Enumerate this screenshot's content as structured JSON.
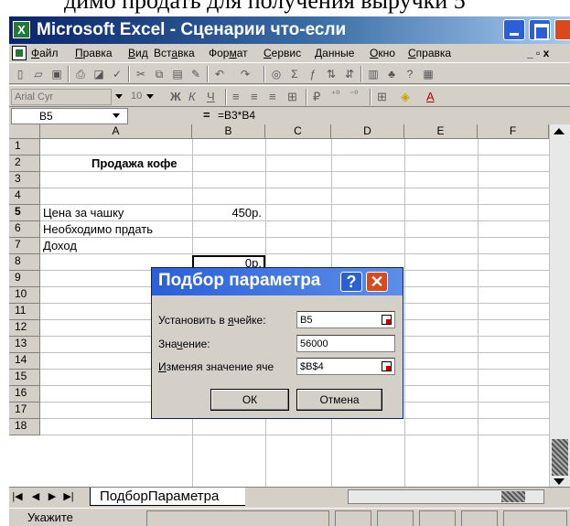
{
  "document_line": "димо продать для получения выручки 5",
  "window": {
    "title": "Microsoft Excel - Сценарии что-если",
    "app_icon": "excel-icon"
  },
  "menu": {
    "items": [
      {
        "pre": "",
        "u": "Ф",
        "post": "айл"
      },
      {
        "pre": "",
        "u": "П",
        "post": "равка"
      },
      {
        "pre": "",
        "u": "В",
        "post": "ид"
      },
      {
        "pre": "Вст",
        "u": "а",
        "post": "вка"
      },
      {
        "pre": "Фор",
        "u": "м",
        "post": "ат"
      },
      {
        "pre": "",
        "u": "С",
        "post": "ервис"
      },
      {
        "pre": "",
        "u": "Д",
        "post": "анные"
      },
      {
        "pre": "",
        "u": "О",
        "post": "кно"
      },
      {
        "pre": "",
        "u": "С",
        "post": "правка"
      }
    ],
    "mdi_controls": "_ ▫ x"
  },
  "format_bar": {
    "font": "Arial Cyr",
    "size": "10",
    "bold": "Ж",
    "italic": "К",
    "underline": "Ч"
  },
  "formula_bar": {
    "name_box": "B5",
    "equals": "=",
    "formula": "=B3*B4"
  },
  "sheet": {
    "columns": [
      "A",
      "B",
      "C",
      "D",
      "E",
      "F"
    ],
    "rows": [
      "1",
      "2",
      "3",
      "4",
      "5",
      "6",
      "7",
      "8",
      "9",
      "10",
      "11",
      "12",
      "13",
      "14",
      "15",
      "16",
      "17",
      "18"
    ],
    "cells": {
      "a1_title": "Продажа кофе",
      "a3": "Цена за чашку",
      "b3": "450р.",
      "a4": "Необходимо прдать",
      "a5": "Доход",
      "b5": "0р."
    }
  },
  "sheet_tab": "ПодборПараметра",
  "status": "Укажите",
  "dialog": {
    "title": "Подбор параметра",
    "help": "?",
    "close": "✕",
    "set_cell_label": {
      "pre": "Установить в ",
      "u": "я",
      "post": "чейке:"
    },
    "set_cell_value": "B5",
    "value_label": {
      "pre": "Зна",
      "u": "ч",
      "post": "ение:"
    },
    "value_value": "56000",
    "changing_label": {
      "pre": "",
      "u": "И",
      "post": "зменяя значение яче"
    },
    "changing_value": "$B$4",
    "ok": "ОК",
    "cancel": "Отмена"
  }
}
